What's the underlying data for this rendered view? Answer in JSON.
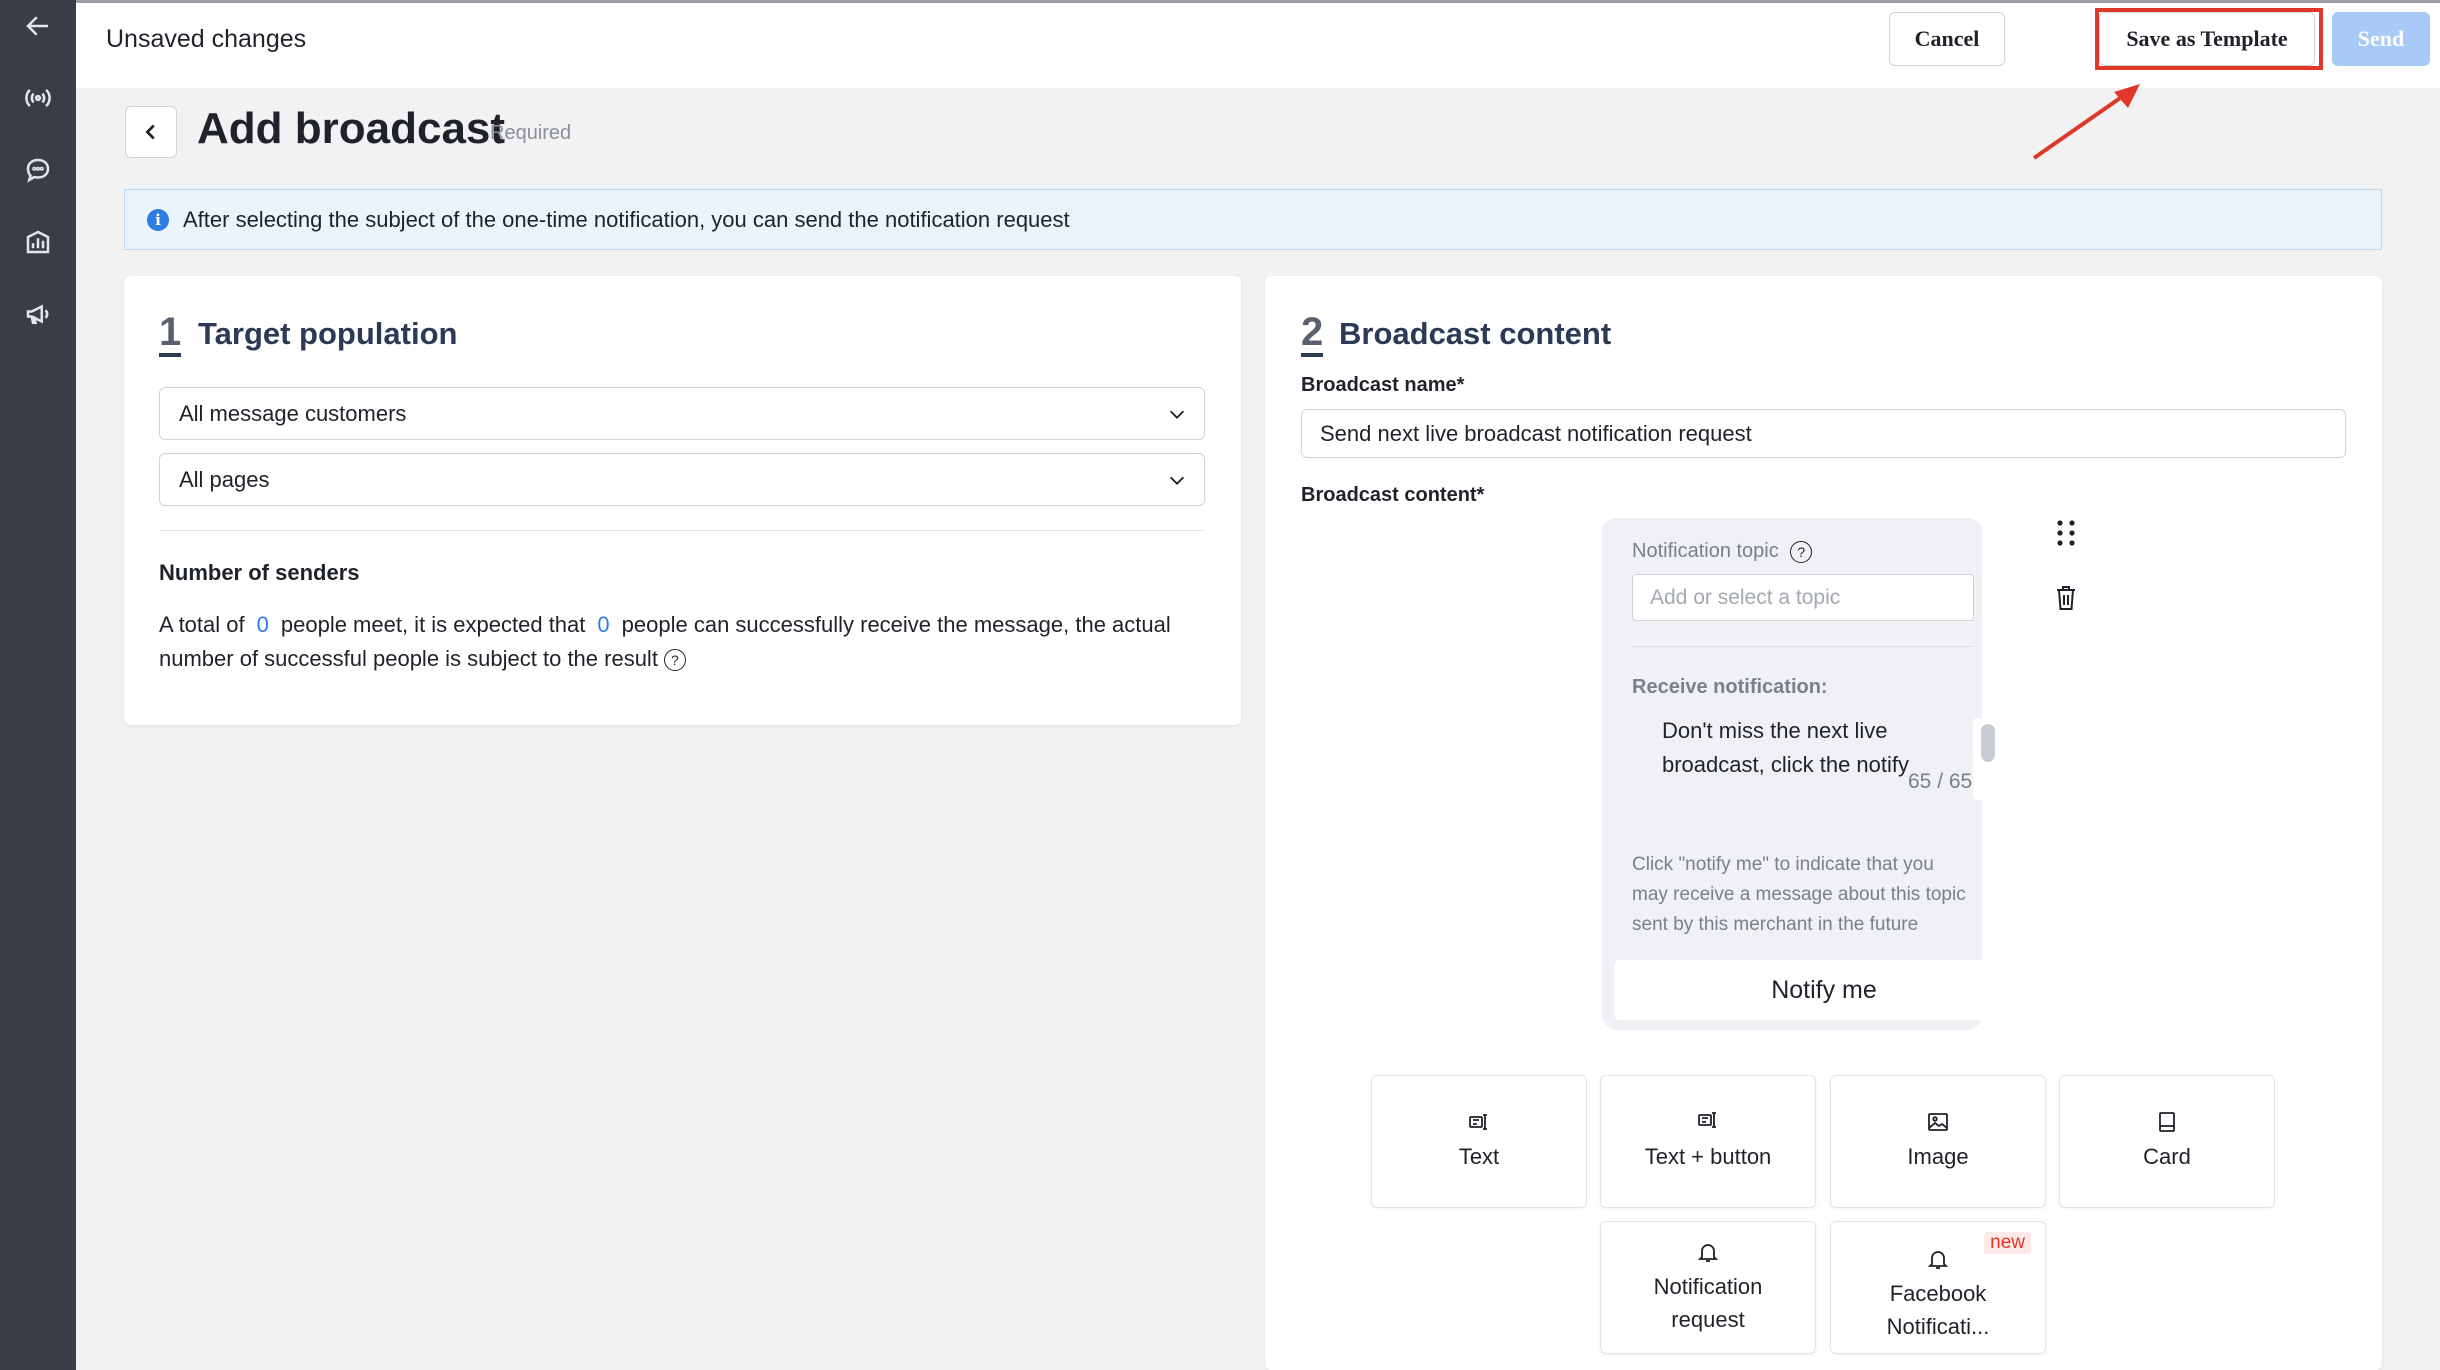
{
  "topbar": {
    "title": "Unsaved changes",
    "cancel_label": "Cancel",
    "save_template_label": "Save as Template",
    "send_label": "Send"
  },
  "header": {
    "title": "Add broadcast",
    "required_tag": "Required"
  },
  "banner": {
    "text": "After selecting the subject of the one-time notification, you can send the notification request"
  },
  "target": {
    "step": "1",
    "title": "Target population",
    "audience_select": "All message customers",
    "pages_select": "All pages",
    "senders_label": "Number of senders",
    "senders_part1": "A total of",
    "meet_count": "0",
    "senders_part2": "people meet, it is expected that",
    "receive_count": "0",
    "senders_part3": "people can successfully receive the message, the actual number of successful people is subject to the result"
  },
  "content": {
    "step": "2",
    "title": "Broadcast content",
    "name_label": "Broadcast name*",
    "name_value": "Send next live broadcast notification request",
    "content_label": "Broadcast content*",
    "preview": {
      "topic_label": "Notification topic",
      "topic_placeholder": "Add or select a topic",
      "receive_label": "Receive notification:",
      "message": "Don't miss the next live broadcast, click the notify",
      "char_count": "65 / 65",
      "description": "Click \"notify me\" to indicate that you may receive a message about this topic sent by this merchant in the future",
      "notify_button": "Notify me"
    },
    "tiles": [
      {
        "label": "Text",
        "icon": "text-icon"
      },
      {
        "label": "Text + button",
        "icon": "text-button-icon"
      },
      {
        "label": "Image",
        "icon": "image-icon"
      },
      {
        "label": "Card",
        "icon": "card-icon"
      },
      {
        "label": "Notification request",
        "icon": "bell-icon"
      },
      {
        "label": "Facebook Notificati...",
        "icon": "bell-icon",
        "badge": "new"
      }
    ]
  },
  "colors": {
    "sidebar": "#3a3d47",
    "accent_blue": "#2f7de1",
    "send_disabled": "#a7cbf6",
    "highlight_red": "#e0372b"
  }
}
